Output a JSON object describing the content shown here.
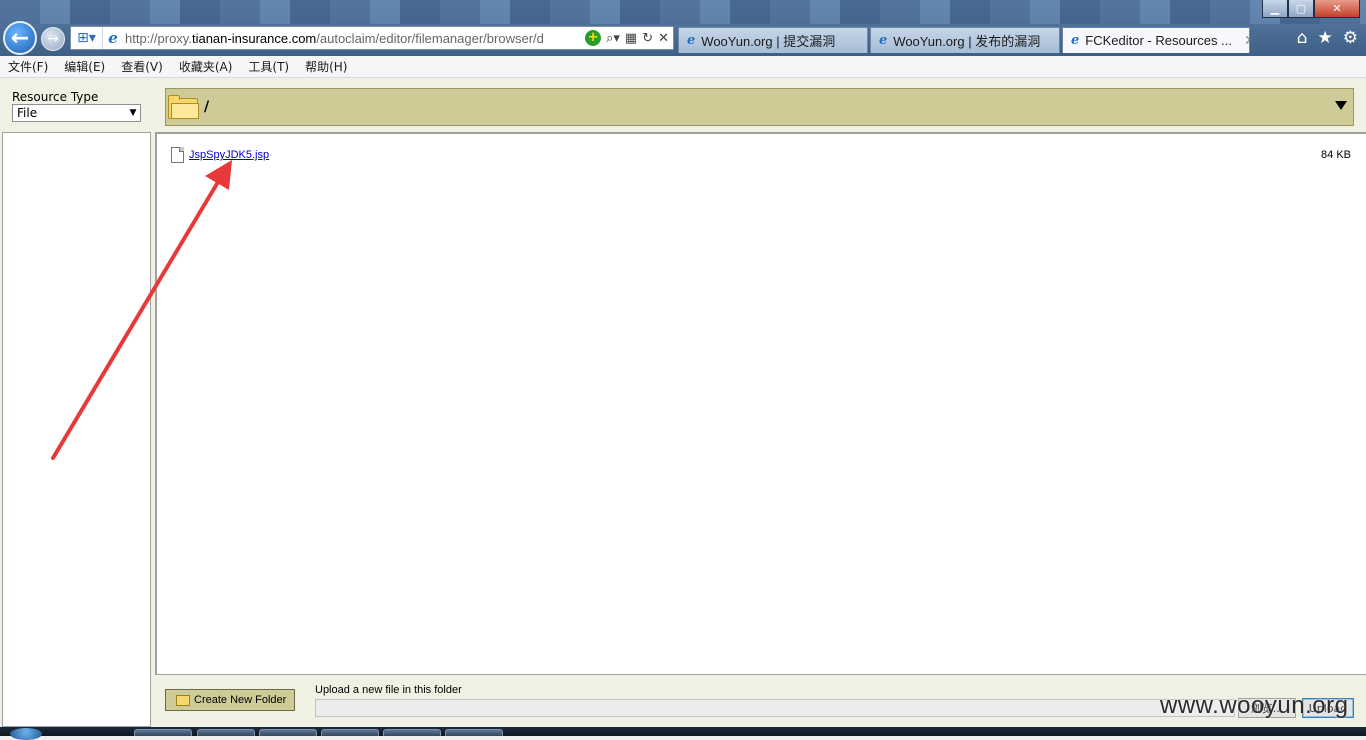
{
  "browser": {
    "address_url_prefix": "http://proxy.",
    "address_url_domain": "tianan-insurance.com",
    "address_url_rest": "/autoclaim/editor/filemanager/browser/d",
    "tabs": [
      {
        "label": "WooYun.org | 提交漏洞"
      },
      {
        "label": "WooYun.org | 发布的漏洞"
      },
      {
        "label": "FCKeditor - Resources ..."
      }
    ],
    "menu": [
      "文件(F)",
      "编辑(E)",
      "查看(V)",
      "收藏夹(A)",
      "工具(T)",
      "帮助(H)"
    ]
  },
  "file_manager": {
    "resource_type_label": "Resource Type",
    "resource_type_value": "File",
    "current_path": "/",
    "files": [
      {
        "name": "JspSpyJDK5.jsp",
        "size": "84 KB"
      }
    ],
    "create_folder_label": "Create New Folder",
    "upload_label": "Upload a new file in this folder",
    "browse_label": "浏览...",
    "upload_button_label": "Upload"
  },
  "watermark": "www.wooyun.org",
  "colors": {
    "panel_bg": "#f1f1e3",
    "path_bar": "#cfcb96",
    "annotation_arrow": "#e8393a",
    "link": "#0000cc"
  }
}
